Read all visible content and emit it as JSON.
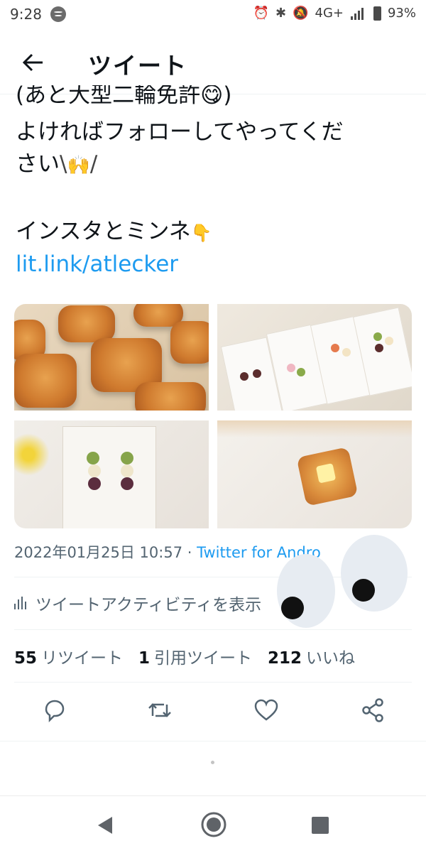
{
  "status_bar": {
    "time": "9:28",
    "network": "4G+",
    "battery": "93%",
    "icons": [
      "spotify-icon",
      "alarm-icon",
      "bluetooth-icon",
      "mute-icon",
      "signal-icon",
      "battery-icon"
    ]
  },
  "header": {
    "title": "ツイート"
  },
  "tweet": {
    "clipped_line": "(あと大型二輪免許😋)",
    "line1": "よければフォローしてやってくだ",
    "line2": "さい",
    "line3": "インスタとミンネ",
    "link": "lit.link/atlecker",
    "date": "2022年01月25日 10:57",
    "separator": "·",
    "source": "Twitter for Andro"
  },
  "activity_label": "ツイートアクティビティを表示",
  "stats": {
    "retweets_count": "55",
    "retweets_label": "リツイート",
    "quotes_count": "1",
    "quotes_label": "引用ツイート",
    "likes_count": "212",
    "likes_label": "いいね"
  },
  "actions": [
    "reply-icon",
    "retweet-icon",
    "like-icon",
    "share-icon"
  ],
  "colors": {
    "accent": "#1d9bf0",
    "secondary_text": "#536471",
    "divider": "#eff3f4",
    "text": "#0f1419"
  }
}
